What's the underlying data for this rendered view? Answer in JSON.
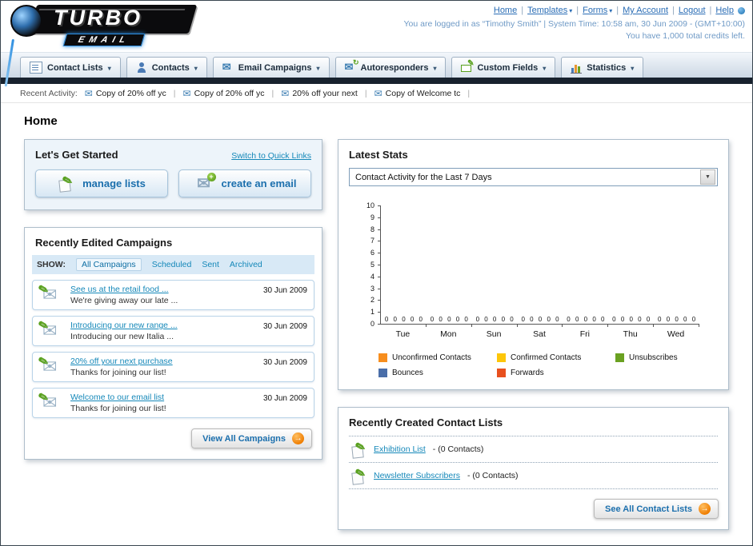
{
  "header": {
    "logo_title": "TURBO",
    "logo_subtitle": "EMAIL",
    "links": [
      {
        "label": "Home",
        "caret": false
      },
      {
        "label": "Templates",
        "caret": true
      },
      {
        "label": "Forms",
        "caret": true
      },
      {
        "label": "My Account",
        "caret": false
      },
      {
        "label": "Logout",
        "caret": false
      },
      {
        "label": "Help",
        "caret": false
      }
    ],
    "login_status": "You are logged in as “Timothy Smith” | System Time: 10:58 am, 30 Jun 2009 - (GMT+10:00)",
    "credits_note": "You have 1,000 total credits left."
  },
  "nav": {
    "tabs": [
      {
        "label": "Contact Lists",
        "icon": "contact-lists-icon"
      },
      {
        "label": "Contacts",
        "icon": "contacts-icon"
      },
      {
        "label": "Email Campaigns",
        "icon": "email-campaigns-icon"
      },
      {
        "label": "Autoresponders",
        "icon": "autoresponders-icon"
      },
      {
        "label": "Custom Fields",
        "icon": "custom-fields-icon"
      },
      {
        "label": "Statistics",
        "icon": "statistics-icon"
      }
    ]
  },
  "recent_activity": {
    "label": "Recent Activity:",
    "items": [
      "Copy of 20% off yc",
      "Copy of 20% off yc",
      "20% off your next",
      "Copy of Welcome tc"
    ]
  },
  "page_title": "Home",
  "get_started": {
    "title": "Let's Get Started",
    "switch_link": "Switch to Quick Links",
    "buttons": [
      {
        "label": "manage lists"
      },
      {
        "label": "create an email"
      }
    ]
  },
  "campaigns": {
    "title": "Recently Edited Campaigns",
    "show_label": "SHOW:",
    "filters": [
      "All Campaigns",
      "Scheduled",
      "Sent",
      "Archived"
    ],
    "active_filter": "All Campaigns",
    "items": [
      {
        "title": "See us at the retail food ...",
        "subtitle": "We're giving away our late ...",
        "date": "30 Jun 2009"
      },
      {
        "title": "Introducing our new range ...",
        "subtitle": "Introducing our new Italia ...",
        "date": "30 Jun 2009"
      },
      {
        "title": "20% off your next purchase",
        "subtitle": "Thanks for joining our list!",
        "date": "30 Jun 2009"
      },
      {
        "title": "Welcome to our email list",
        "subtitle": "Thanks for joining our list!",
        "date": "30 Jun 2009"
      }
    ],
    "view_all_label": "View All Campaigns"
  },
  "stats": {
    "title": "Latest Stats",
    "dropdown_value": "Contact Activity for the Last 7 Days",
    "chart_data": {
      "type": "bar",
      "title": "Contact Activity for the Last 7 Days",
      "categories": [
        "Tue",
        "Mon",
        "Sun",
        "Sat",
        "Fri",
        "Thu",
        "Wed"
      ],
      "series": [
        {
          "name": "Unconfirmed Contacts",
          "color": "#f78e1e",
          "values": [
            0,
            0,
            0,
            0,
            0,
            0,
            0
          ]
        },
        {
          "name": "Confirmed Contacts",
          "color": "#fdc609",
          "values": [
            0,
            0,
            0,
            0,
            0,
            0,
            0
          ]
        },
        {
          "name": "Unsubscribes",
          "color": "#6aa121",
          "values": [
            0,
            0,
            0,
            0,
            0,
            0,
            0
          ]
        },
        {
          "name": "Bounces",
          "color": "#4a6ea9",
          "values": [
            0,
            0,
            0,
            0,
            0,
            0,
            0
          ]
        },
        {
          "name": "Forwards",
          "color": "#e8501e",
          "values": [
            0,
            0,
            0,
            0,
            0,
            0,
            0
          ]
        }
      ],
      "xlabel": "",
      "ylabel": "",
      "ylim": [
        0,
        10
      ],
      "yticks": [
        0,
        1,
        2,
        3,
        4,
        5,
        6,
        7,
        8,
        9,
        10
      ],
      "grid": false,
      "legend_position": "bottom"
    }
  },
  "contact_lists": {
    "title": "Recently Created Contact Lists",
    "items": [
      {
        "name": "Exhibition List",
        "suffix": "- (0 Contacts)"
      },
      {
        "name": "Newsletter Subscribers",
        "suffix": "- (0 Contacts)"
      }
    ],
    "see_all_label": "See All Contact Lists"
  },
  "colors": {
    "accent_orange": "#ef7d00",
    "link_blue": "#1588b9",
    "nav_dark_bar": "#18222e"
  }
}
